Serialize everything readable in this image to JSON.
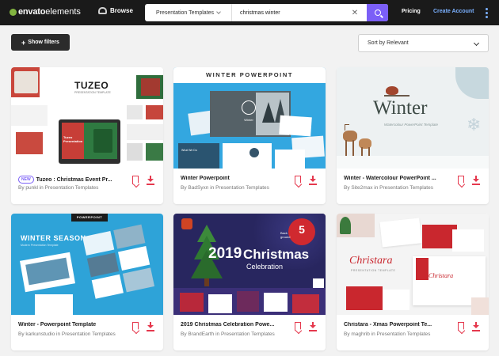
{
  "nav": {
    "logo_bold": "envato",
    "logo_light": "elements",
    "browse_label": "Browse",
    "search_category": "Presentation Templates",
    "search_query": "christmas winter",
    "pricing_label": "Pricing",
    "create_account_label": "Create Account"
  },
  "toolbar": {
    "show_filters_label": "Show filters",
    "sort_label": "Sort by Relevant"
  },
  "colors": {
    "accent_purple": "#7b5ff7",
    "action_red": "#e5384d",
    "brand_green": "#82b440",
    "link_blue": "#7ab0ff"
  },
  "cards": [
    {
      "badge": "NEW",
      "title": "Tuzeo : Christmas Event Pr...",
      "meta": "By punkl in Presentation Templates",
      "thumb_heading": "TUZEO",
      "thumb_sub": "PRESENTATION TEMPLATE",
      "thumb_inner": "Tuzeo Presentation"
    },
    {
      "title": "Winter Powerpoint",
      "meta": "By BadSyxn in Presentation Templates",
      "thumb_heading": "WINTER POWERPOINT",
      "thumb_inner": "Winter",
      "thumb_small": "What We Do"
    },
    {
      "title": "Winter - Watercolour PowerPoint ...",
      "meta": "By Site2max in Presentation Templates",
      "thumb_heading": "Winter",
      "thumb_sub": "Watercolour PowerPoint Template"
    },
    {
      "title": "Winter - Powerpoint Template",
      "meta": "By karkunstudio in Presentation Templates",
      "thumb_tag": "POWERPOINT",
      "thumb_heading": "WINTER SEASON",
      "thumb_sub": "Modern Presentation Template"
    },
    {
      "title": "2019 Christmas Celebration Powe...",
      "meta": "By BrandEarth in Presentation Templates",
      "thumb_year": "2019",
      "thumb_heading": "Christmas",
      "thumb_sub": "Celebration",
      "thumb_badge_num": "5",
      "thumb_badge_text": "Back ground"
    },
    {
      "title": "Christara - Xmas Powerpoint Te...",
      "meta": "By maghrib in Presentation Templates",
      "thumb_heading": "Christara",
      "thumb_sub": "PRESENTATION TEMPLATE"
    }
  ]
}
